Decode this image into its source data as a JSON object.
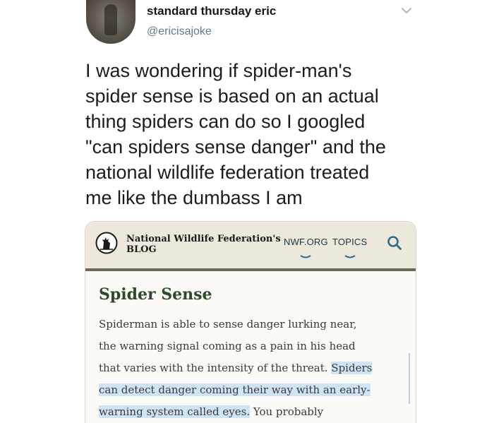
{
  "tweet": {
    "display_name": "standard thursday eric",
    "handle": "@ericisajoke",
    "text_lines": [
      "I was wondering if spider-man's",
      "spider sense is based on an actual",
      "thing spiders can do so I googled",
      "\"can spiders sense danger\" and the",
      "national wildlife federation treated",
      "me like the dumbass I am"
    ]
  },
  "card": {
    "brand_line1": "National Wildlife Federation's",
    "brand_line2": "BLOG",
    "nav": {
      "nwf": "NWF.ORG",
      "topics": "TOPICS"
    },
    "article_title": "Spider Sense",
    "body": {
      "line1": "Spiderman is able to sense danger lurking near,",
      "line2": "the warning signal coming as a pain in his head",
      "line3_plain": "that varies with the intensity of the threat. ",
      "line3_hl": "Spiders",
      "line4_hl": "can detect danger coming their way with an early-",
      "line5_hl": "warning system called eyes.",
      "line5_plain": " You probably"
    }
  },
  "colors": {
    "name": "#14171a",
    "handle": "#657786",
    "header_bg": "#ece9dc",
    "header_rule": "#6b6a58",
    "title_green": "#2f4a2a",
    "highlight": "#cfe4f7"
  },
  "icons": {
    "menu": "chevron-down-icon",
    "search": "search-icon",
    "logo": "deer-logo-icon"
  }
}
